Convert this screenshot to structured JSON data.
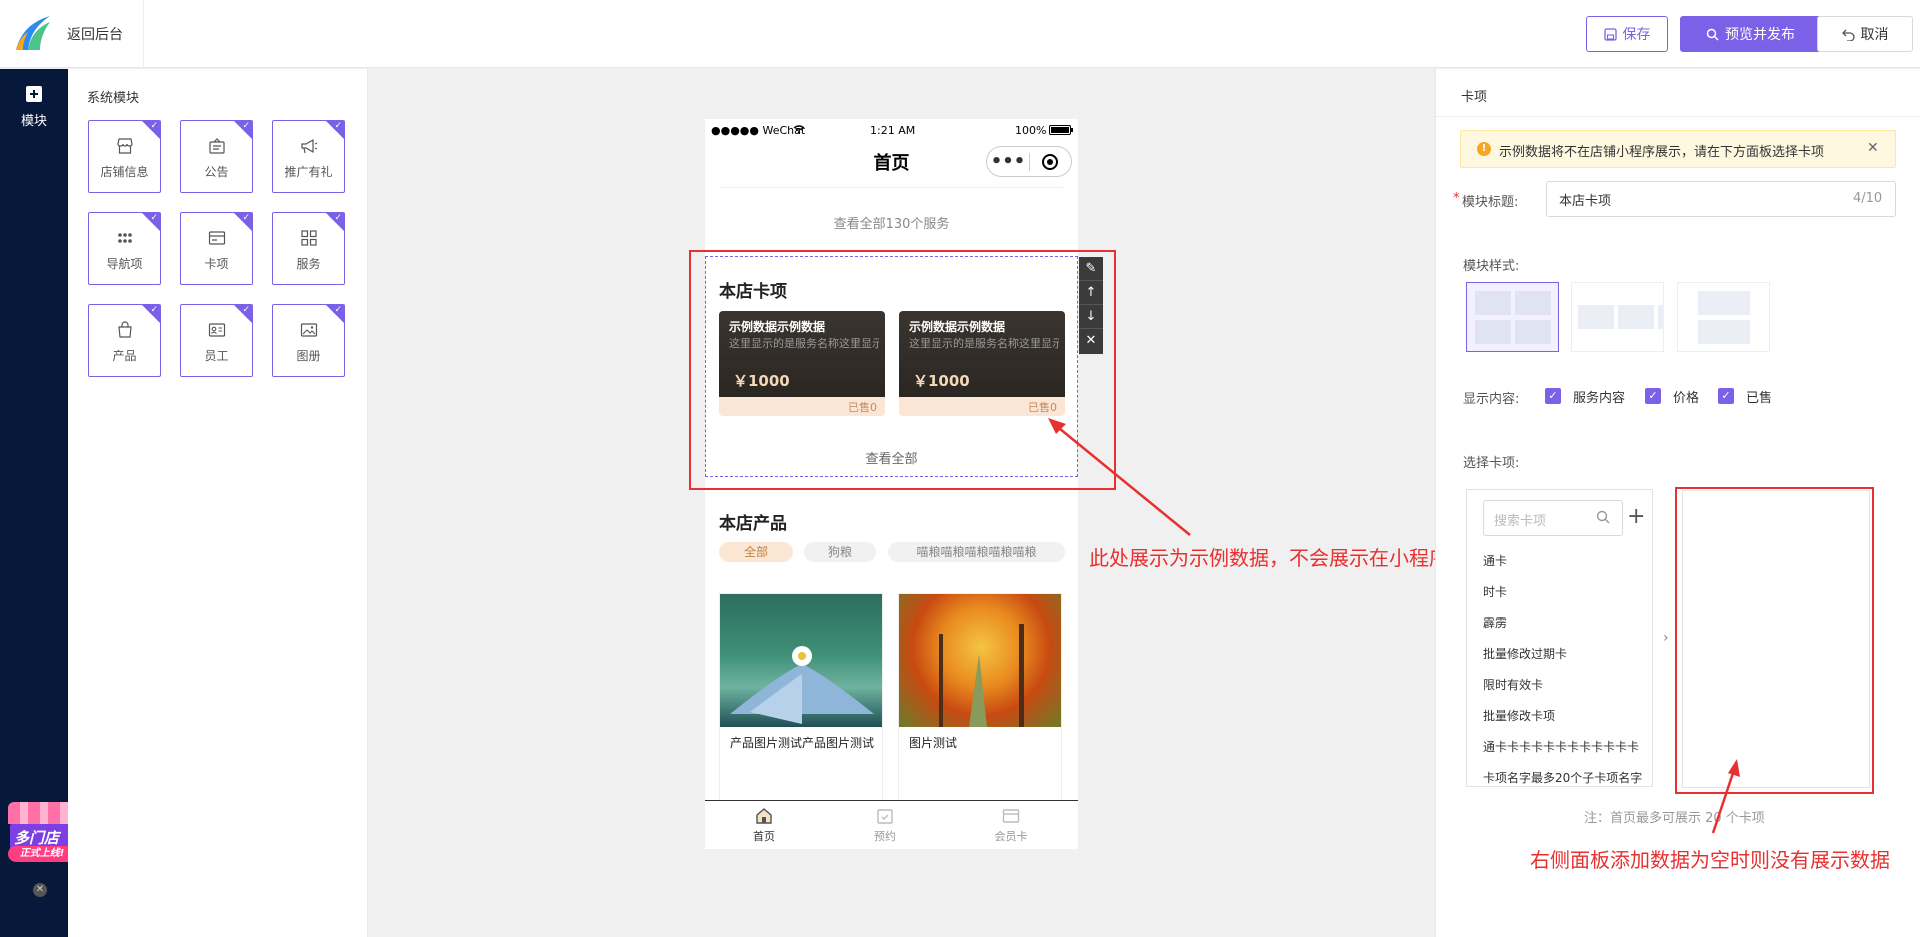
{
  "header": {
    "back_label": "返回后台",
    "save_label": "保存",
    "publish_label": "预览并发布",
    "cancel_label": "取消"
  },
  "nav": {
    "modules_label": "模块"
  },
  "promo": {
    "line1": "多门店",
    "line2": "正式上线!"
  },
  "module_panel": {
    "title": "系统模块",
    "items": [
      {
        "label": "店铺信息",
        "icon": "store-icon"
      },
      {
        "label": "公告",
        "icon": "notice-icon"
      },
      {
        "label": "推广有礼",
        "icon": "megaphone-icon"
      },
      {
        "label": "导航项",
        "icon": "grid-dots-icon"
      },
      {
        "label": "卡项",
        "icon": "card-icon"
      },
      {
        "label": "服务",
        "icon": "apps-icon"
      },
      {
        "label": "产品",
        "icon": "bag-icon"
      },
      {
        "label": "员工",
        "icon": "id-card-icon"
      },
      {
        "label": "图册",
        "icon": "image-icon"
      }
    ]
  },
  "phone": {
    "status_left": "●●●●● WeChat",
    "status_time": "1:21 AM",
    "status_right": "100%",
    "page_title": "首页",
    "view_all_services": "查看全部130个服务",
    "card_section": {
      "title": "本店卡项",
      "cards": [
        {
          "title": "示例数据示例数据",
          "desc": "这里显示的是服务名称这里显示",
          "price": "￥1000",
          "sold": "已售0"
        },
        {
          "title": "示例数据示例数据",
          "desc": "这里显示的是服务名称这里显示",
          "price": "￥1000",
          "sold": "已售0"
        }
      ],
      "view_all": "查看全部"
    },
    "product_section": {
      "title": "本店产品",
      "tabs": [
        "全部",
        "狗粮",
        "喵粮喵粮喵粮喵粮喵粮"
      ],
      "products": [
        {
          "name": "产品图片测试产品图片测试"
        },
        {
          "name": "图片测试"
        }
      ]
    },
    "tabbar": [
      "首页",
      "预约",
      "会员卡"
    ]
  },
  "annotations": {
    "left": "此处展示为示例数据，不会展示在小程序",
    "right": "右侧面板添加数据为空时则没有展示数据"
  },
  "right_panel": {
    "title": "卡项",
    "notice": "示例数据将不在店铺小程序展示，请在下方面板选择卡项",
    "module_title_label": "模块标题:",
    "module_title_value": "本店卡项",
    "module_title_count": "4/10",
    "style_label": "模块样式:",
    "display_label": "显示内容:",
    "display_options": [
      "服务内容",
      "价格",
      "已售"
    ],
    "select_label": "选择卡项:",
    "search_placeholder": "搜索卡项",
    "card_list": [
      "通卡",
      "时卡",
      "霹雳",
      "批量修改过期卡",
      "限时有效卡",
      "批量修改卡项",
      "通卡卡卡卡卡卡卡卡卡卡卡卡",
      "卡项名字最多20个子卡项名字"
    ],
    "note": "注：首页最多可展示 20 个卡项"
  },
  "colors": {
    "accent": "#7b61e8",
    "annotation": "#e83030",
    "nav_bg": "#06193a"
  }
}
